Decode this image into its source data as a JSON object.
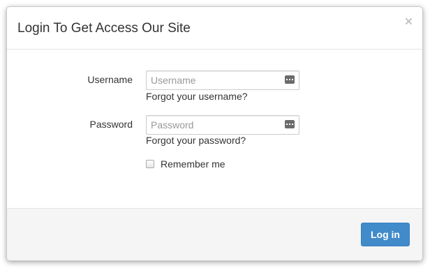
{
  "modal": {
    "title": "Login To Get Access Our Site",
    "close_symbol": "×"
  },
  "form": {
    "username": {
      "label": "Username",
      "placeholder": "Username",
      "value": "",
      "icon": "keyboard-icon",
      "forgot_link": "Forgot your username?"
    },
    "password": {
      "label": "Password",
      "placeholder": "Password",
      "value": "",
      "icon": "keyboard-icon",
      "forgot_link": "Forgot your password?"
    },
    "remember": {
      "label": "Remember me",
      "checked": false
    }
  },
  "footer": {
    "login_label": "Log in"
  },
  "colors": {
    "primary": "#428bca",
    "footer_bg": "#f5f5f5",
    "text": "#333333"
  }
}
